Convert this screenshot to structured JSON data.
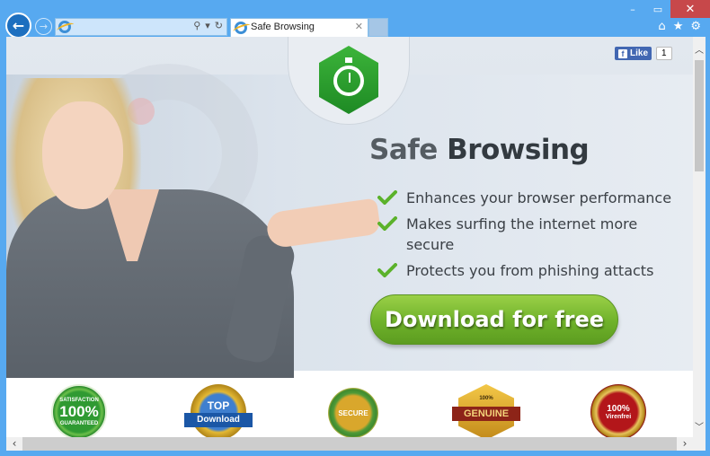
{
  "window": {
    "minimize_icon": "minimize-icon",
    "maximize_icon": "maximize-icon",
    "close_icon": "close-icon",
    "minimize": "–",
    "maximize": "▭",
    "close": "✕"
  },
  "nav": {
    "back": "←",
    "forward": "→",
    "address_value": "",
    "search_glyph": "⚲",
    "dropdown_glyph": "▾",
    "refresh_glyph": "↻"
  },
  "tabs": [
    {
      "label": "Safe Browsing",
      "close": "✕"
    }
  ],
  "toolbar": {
    "home": "⌂",
    "favorites": "★",
    "settings": "⚙"
  },
  "page": {
    "facebook": {
      "like_label": "Like",
      "count": "1",
      "f": "f"
    },
    "headline_part1": "Safe",
    "headline_part2": "Browsing",
    "features": [
      "Enhances your browser performance",
      "Makes surfing the internet more secure",
      "Protects you from phishing attacts"
    ],
    "download_label": "Download for free",
    "badges": [
      {
        "name": "satisfaction-guaranteed",
        "top": "SATISFACTION",
        "main": "100%",
        "bottom": "GUARANTEED"
      },
      {
        "name": "top-download",
        "top": "TOP",
        "main": "Download"
      },
      {
        "name": "secure",
        "main": "SECURE"
      },
      {
        "name": "genuine-product",
        "top": "100%",
        "main": "GENUINE"
      },
      {
        "name": "virenfrei",
        "main": "100%",
        "bottom": "Virenfrei"
      }
    ]
  },
  "scrollbars": {
    "up": "︿",
    "down": "﹀",
    "left": "‹",
    "right": "›"
  }
}
